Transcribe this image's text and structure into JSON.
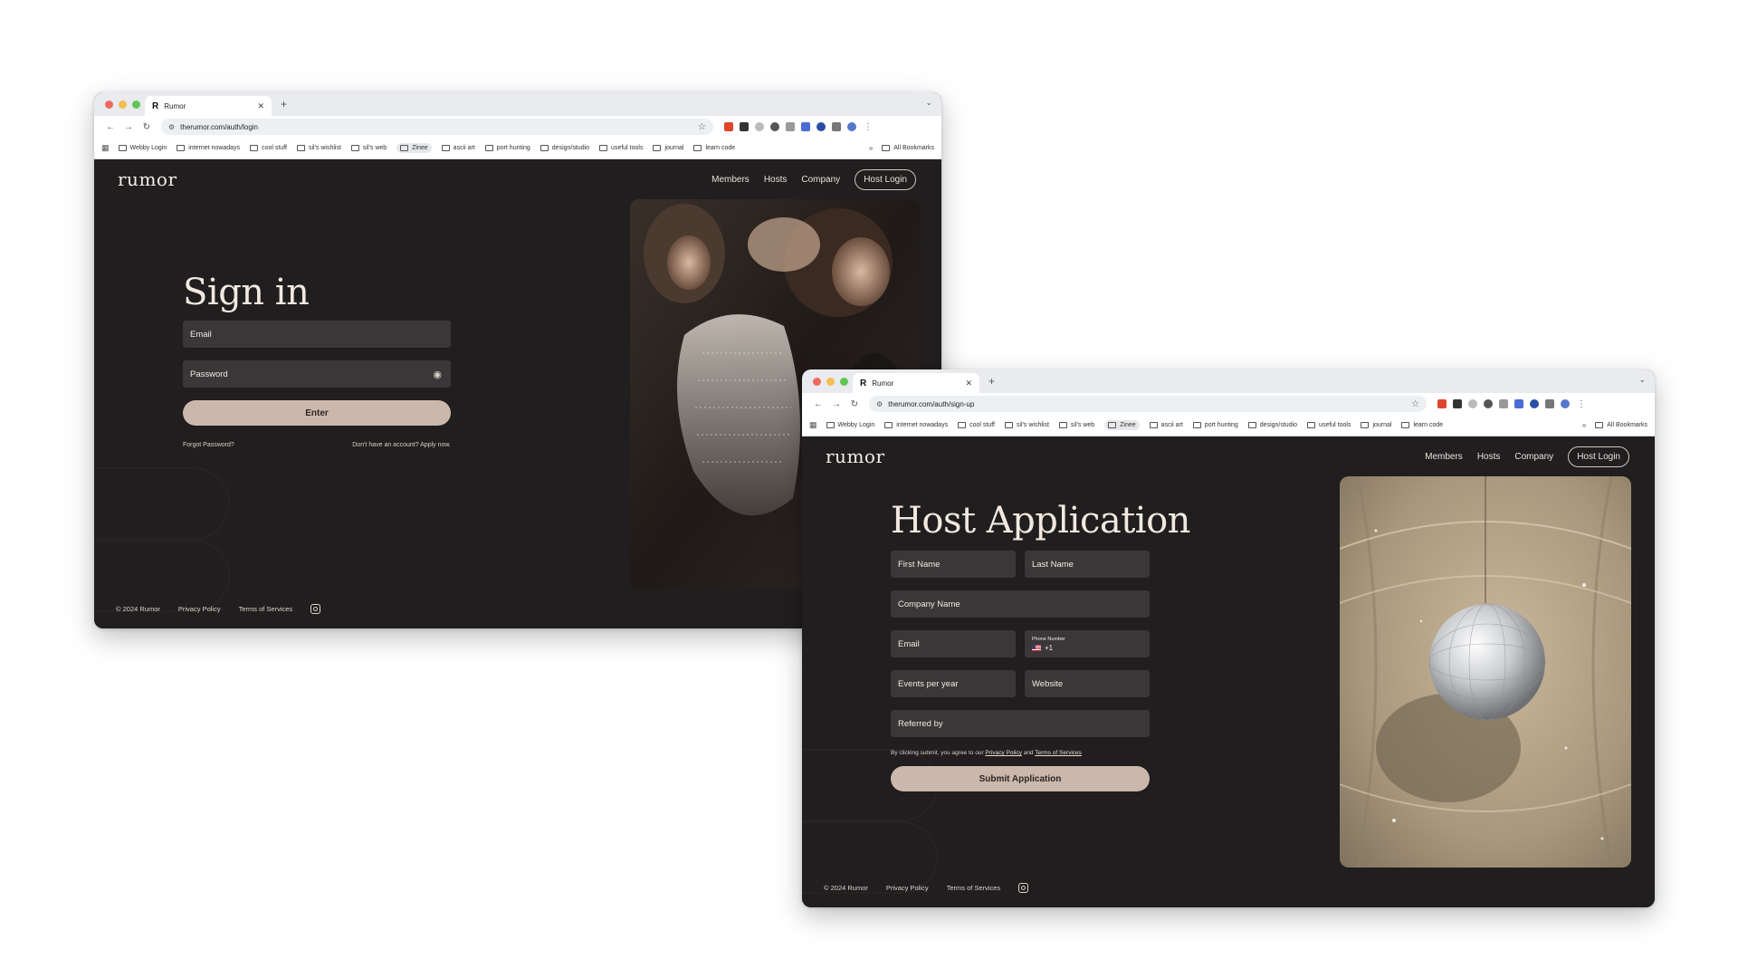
{
  "login_window": {
    "tab_title": "Rumor",
    "url": "therumor.com/auth/login",
    "bookmarks": [
      "Webby Login",
      "internet nowadays",
      "cool stuff",
      "sil's wishlist",
      "sil's web",
      "Zinee",
      "ascii art",
      "port hunting",
      "design/studio",
      "useful tools",
      "journal",
      "learn code"
    ],
    "all_bookmarks": "All Bookmarks",
    "logo": "rumor",
    "nav": [
      "Members",
      "Hosts",
      "Company"
    ],
    "host_login": "Host Login",
    "title": "Sign in",
    "email_placeholder": "Email",
    "password_placeholder": "Password",
    "enter_label": "Enter",
    "forgot_password": "Forgot Password?",
    "apply_prompt": "Don't have an account? Apply now.",
    "copyright": "© 2024 Rumor",
    "privacy": "Privacy Policy",
    "terms": "Terms of Services"
  },
  "signup_window": {
    "tab_title": "Rumor",
    "url": "therumor.com/auth/sign-up",
    "bookmarks": [
      "Webby Login",
      "internet nowadays",
      "cool stuff",
      "sil's wishlist",
      "sil's web",
      "Zinee",
      "ascii art",
      "port hunting",
      "design/studio",
      "useful tools",
      "journal",
      "learn code"
    ],
    "all_bookmarks": "All Bookmarks",
    "logo": "rumor",
    "nav": [
      "Members",
      "Hosts",
      "Company"
    ],
    "host_login": "Host Login",
    "title": "Host Application",
    "first_name": "First Name",
    "last_name": "Last Name",
    "company_name": "Company Name",
    "email": "Email",
    "phone_label": "Phone Number",
    "phone_code": "+1",
    "events_per_year": "Events per year",
    "website": "Website",
    "referred_by": "Referred by",
    "agree_prefix": "By clicking submit, you agree to our",
    "agree_privacy": "Privacy Policy",
    "agree_and": "and",
    "agree_terms": "Terms of Services",
    "submit_label": "Submit Application",
    "copyright": "© 2024 Rumor",
    "privacy": "Privacy Policy",
    "terms": "Terms of Services"
  },
  "colors": {
    "page_bg": "#201e1e",
    "field_bg": "#3a3738",
    "button_bg": "#cbb8ac",
    "text": "#f1e9e0"
  }
}
